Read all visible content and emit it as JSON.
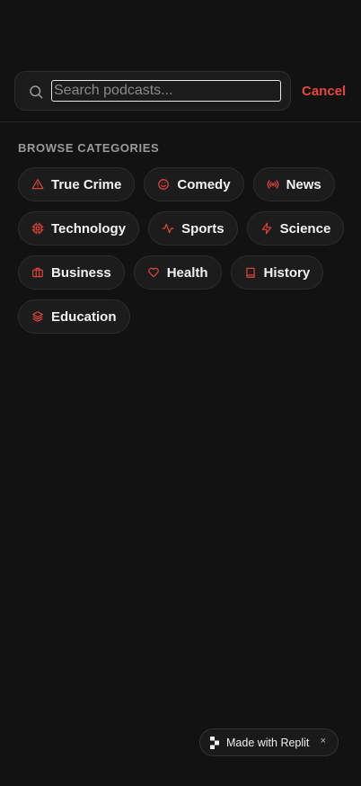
{
  "search": {
    "placeholder": "Search podcasts...",
    "value": ""
  },
  "cancel_label": "Cancel",
  "section_title": "BROWSE CATEGORIES",
  "categories": [
    {
      "label": "True Crime",
      "icon": "alert-triangle-icon"
    },
    {
      "label": "Comedy",
      "icon": "smile-icon"
    },
    {
      "label": "News",
      "icon": "radio-icon"
    },
    {
      "label": "Technology",
      "icon": "cpu-icon"
    },
    {
      "label": "Sports",
      "icon": "activity-icon"
    },
    {
      "label": "Science",
      "icon": "zap-icon"
    },
    {
      "label": "Business",
      "icon": "briefcase-icon"
    },
    {
      "label": "Health",
      "icon": "heart-icon"
    },
    {
      "label": "History",
      "icon": "book-icon"
    },
    {
      "label": "Education",
      "icon": "layers-icon"
    }
  ],
  "badge": {
    "label": "Made with Replit",
    "close": "×"
  },
  "colors": {
    "accent": "#e5483c",
    "background": "#121212",
    "chip": "#1c1c1c"
  }
}
